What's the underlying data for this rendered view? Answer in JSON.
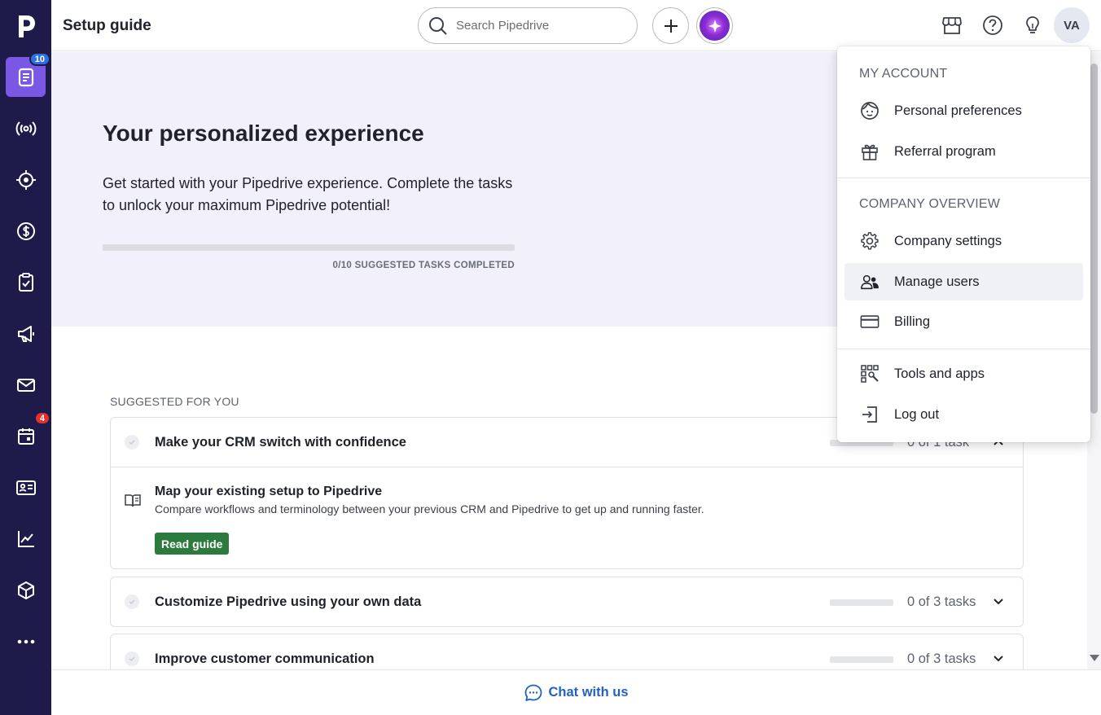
{
  "header": {
    "title": "Setup guide",
    "search_placeholder": "Search Pipedrive",
    "avatar_initials": "VA"
  },
  "sidebar": {
    "logo": "p",
    "items": [
      {
        "name": "setup-guide",
        "icon": "document-list-icon",
        "badge": "10",
        "badge_color": "#2f6fe0",
        "active": true
      },
      {
        "name": "leads",
        "icon": "broadcast-icon"
      },
      {
        "name": "target",
        "icon": "target-icon"
      },
      {
        "name": "deals",
        "icon": "dollar-icon"
      },
      {
        "name": "activities",
        "icon": "clipboard-check-icon"
      },
      {
        "name": "campaigns",
        "icon": "megaphone-icon"
      },
      {
        "name": "mail",
        "icon": "mail-icon"
      },
      {
        "name": "calendar",
        "icon": "calendar-icon",
        "badge": "4",
        "badge_color": "#e0312f"
      },
      {
        "name": "contacts",
        "icon": "contact-card-icon"
      },
      {
        "name": "insights",
        "icon": "chart-icon"
      },
      {
        "name": "products",
        "icon": "box-icon"
      },
      {
        "name": "more",
        "icon": "more-icon"
      }
    ]
  },
  "hero": {
    "title": "Your personalized experience",
    "description": "Get started with your Pipedrive experience. Complete the tasks to unlock your maximum Pipedrive potential!",
    "progress_fraction": 0.0,
    "progress_label": "0/10 SUGGESTED TASKS COMPLETED"
  },
  "suggested": {
    "label": "SUGGESTED FOR YOU",
    "cards": [
      {
        "title": "Make your CRM switch with confidence",
        "task_count": "0 of 1 task",
        "progress_fraction": 0.0,
        "expanded": true,
        "body": {
          "title": "Map your existing setup to Pipedrive",
          "description": "Compare workflows and terminology between your previous CRM and Pipedrive to get up and running faster.",
          "button": "Read guide"
        }
      },
      {
        "title": "Customize Pipedrive using your own data",
        "task_count": "0 of 3 tasks",
        "progress_fraction": 0.0,
        "expanded": false
      },
      {
        "title": "Improve customer communication",
        "task_count": "0 of 3 tasks",
        "progress_fraction": 0.0,
        "expanded": false
      }
    ]
  },
  "footer": {
    "chat_label": "Chat with us"
  },
  "menu": {
    "my_account_heading": "MY ACCOUNT",
    "company_heading": "COMPANY OVERVIEW",
    "items": {
      "personal_preferences": "Personal preferences",
      "referral_program": "Referral program",
      "company_settings": "Company settings",
      "manage_users": "Manage users",
      "billing": "Billing",
      "tools_and_apps": "Tools and apps",
      "log_out": "Log out"
    }
  },
  "colors": {
    "sidebar_bg": "#1e1b4b",
    "sidebar_active": "#7b57e6",
    "hero_bg": "#f1f0fb",
    "guide_button": "#2c7a3e",
    "chat_link": "#2262c4"
  }
}
